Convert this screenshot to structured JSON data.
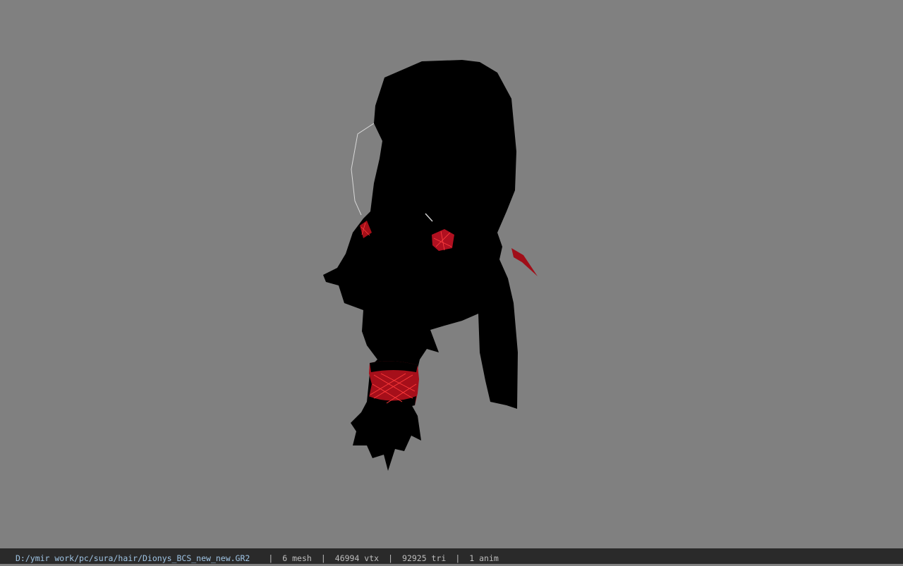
{
  "viewport": {
    "background": "#808080",
    "model_color": "#000000",
    "accent_color": "#c0121e"
  },
  "statusbar": {
    "file_path": "D:/ymir work/pc/sura/hair/Dionys_BCS_new_new.GR2",
    "separator": "|",
    "mesh_count": "6 mesh",
    "vertex_count": "46994 vtx",
    "triangle_count": "92925 tri",
    "anim_count": "1 anim",
    "background": "#2a2a2a",
    "path_color": "#9fc4e4"
  }
}
